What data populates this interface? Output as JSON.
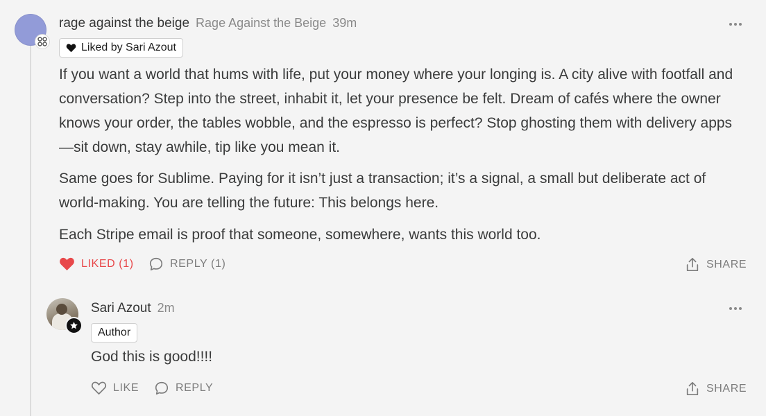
{
  "comment": {
    "username": "rage against the beige",
    "publication": "Rage Against the Beige",
    "time": "39m",
    "liked_by": "Liked by Sari Azout",
    "paragraphs": [
      "If you want a world that hums with life, put your money where your longing is. A city alive with footfall and conversation? Step into the street, inhabit it, let your presence be felt. Dream of cafés where the owner knows your order, the tables wobble, and the espresso is perfect? Stop ghosting them with delivery apps—sit down, stay awhile, tip like you mean it.",
      "Same goes for Sublime. Paying for it isn’t just a transaction; it’s a signal, a small but deliberate act of world-making. You are telling the future: This belongs here.",
      "Each Stripe email is proof that someone, somewhere, wants this world too."
    ],
    "actions": {
      "liked_label": "LIKED (1)",
      "reply_label": "REPLY (1)",
      "share_label": "SHARE"
    }
  },
  "reply": {
    "username": "Sari Azout",
    "time": "2m",
    "badge": "Author",
    "text": "God this is good!!!!",
    "actions": {
      "like_label": "LIKE",
      "reply_label": "REPLY",
      "share_label": "SHARE"
    }
  },
  "colors": {
    "liked": "#e8484a",
    "muted": "#7c7c7c",
    "text": "#363737",
    "background": "#f4f4f4"
  },
  "icons": [
    "heart-icon",
    "comment-bubble-icon",
    "share-icon",
    "more-icon",
    "star-icon",
    "subscriber-icon"
  ]
}
